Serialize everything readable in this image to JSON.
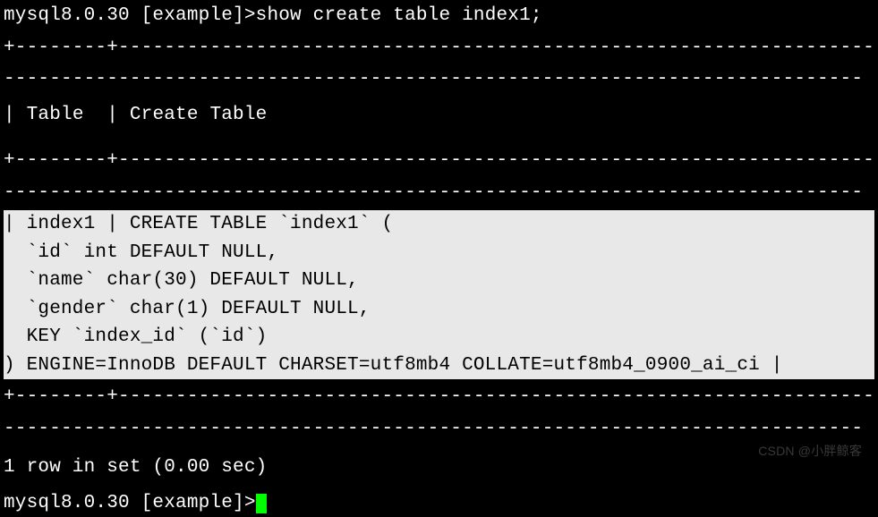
{
  "prompt1": {
    "prefix": "mysql8.0.30 [example]>",
    "command": "show create table index1;"
  },
  "separators": {
    "top": "+--------+------------------------------------------------------------------",
    "dashes": "---------------------------------------------------------------------------",
    "mid": "+--------+------------------------------------------------------------------",
    "bot": "+--------+------------------------------------------------------------------"
  },
  "header": {
    "col1": "Table",
    "col2": "Create Table"
  },
  "result": {
    "table_name": "index1",
    "ddl_lines": {
      "l1": "| index1 | CREATE TABLE `index1` (",
      "l2": "  `id` int DEFAULT NULL,",
      "l3": "  `name` char(30) DEFAULT NULL,",
      "l4": "  `gender` char(1) DEFAULT NULL,",
      "l5": "  KEY `index_id` (`id`)",
      "l6": ") ENGINE=InnoDB DEFAULT CHARSET=utf8mb4 COLLATE=utf8mb4_0900_ai_ci |"
    }
  },
  "footer": {
    "rows_msg": "1 row in set (0.00 sec)"
  },
  "prompt2": {
    "prefix": "mysql8.0.30 [example]>"
  },
  "watermark": "CSDN @小胖鲸客"
}
